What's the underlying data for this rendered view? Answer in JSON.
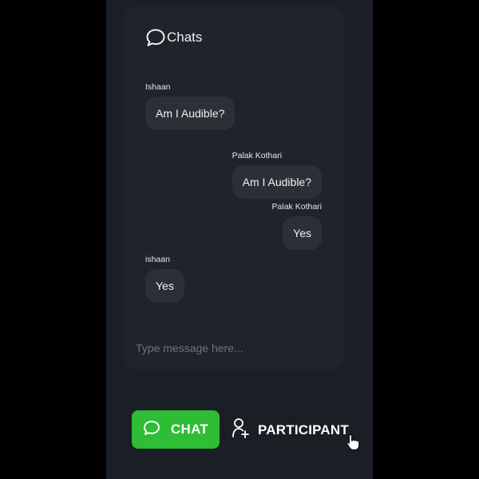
{
  "chat_panel": {
    "title": "Chats",
    "header_icon": "chat-bubble-icon",
    "messages": [
      {
        "sender": "Ishaan",
        "text": "Am I Audible?",
        "align": "left"
      },
      {
        "sender": "Palak Kothari",
        "text": "Am I Audible?",
        "align": "right"
      },
      {
        "sender": "Palak Kothari",
        "text": "Yes",
        "align": "right"
      },
      {
        "sender": "ishaan",
        "text": "Yes",
        "align": "left"
      }
    ],
    "input": {
      "placeholder": "Type message here...",
      "value": ""
    }
  },
  "bottom_bar": {
    "chat_label": "CHAT",
    "chat_icon": "chat-bubble-icon",
    "participant_label": "PARTICIPANT",
    "participant_icon": "person-add-icon"
  },
  "colors": {
    "page_background": "#000000",
    "phone_background": "#1a1e25",
    "panel_background": "#1f232a",
    "bubble_background": "#2b2f36",
    "accent_green": "#2ebd35",
    "text_primary": "#f1f2f4",
    "placeholder": "#6e737b"
  }
}
